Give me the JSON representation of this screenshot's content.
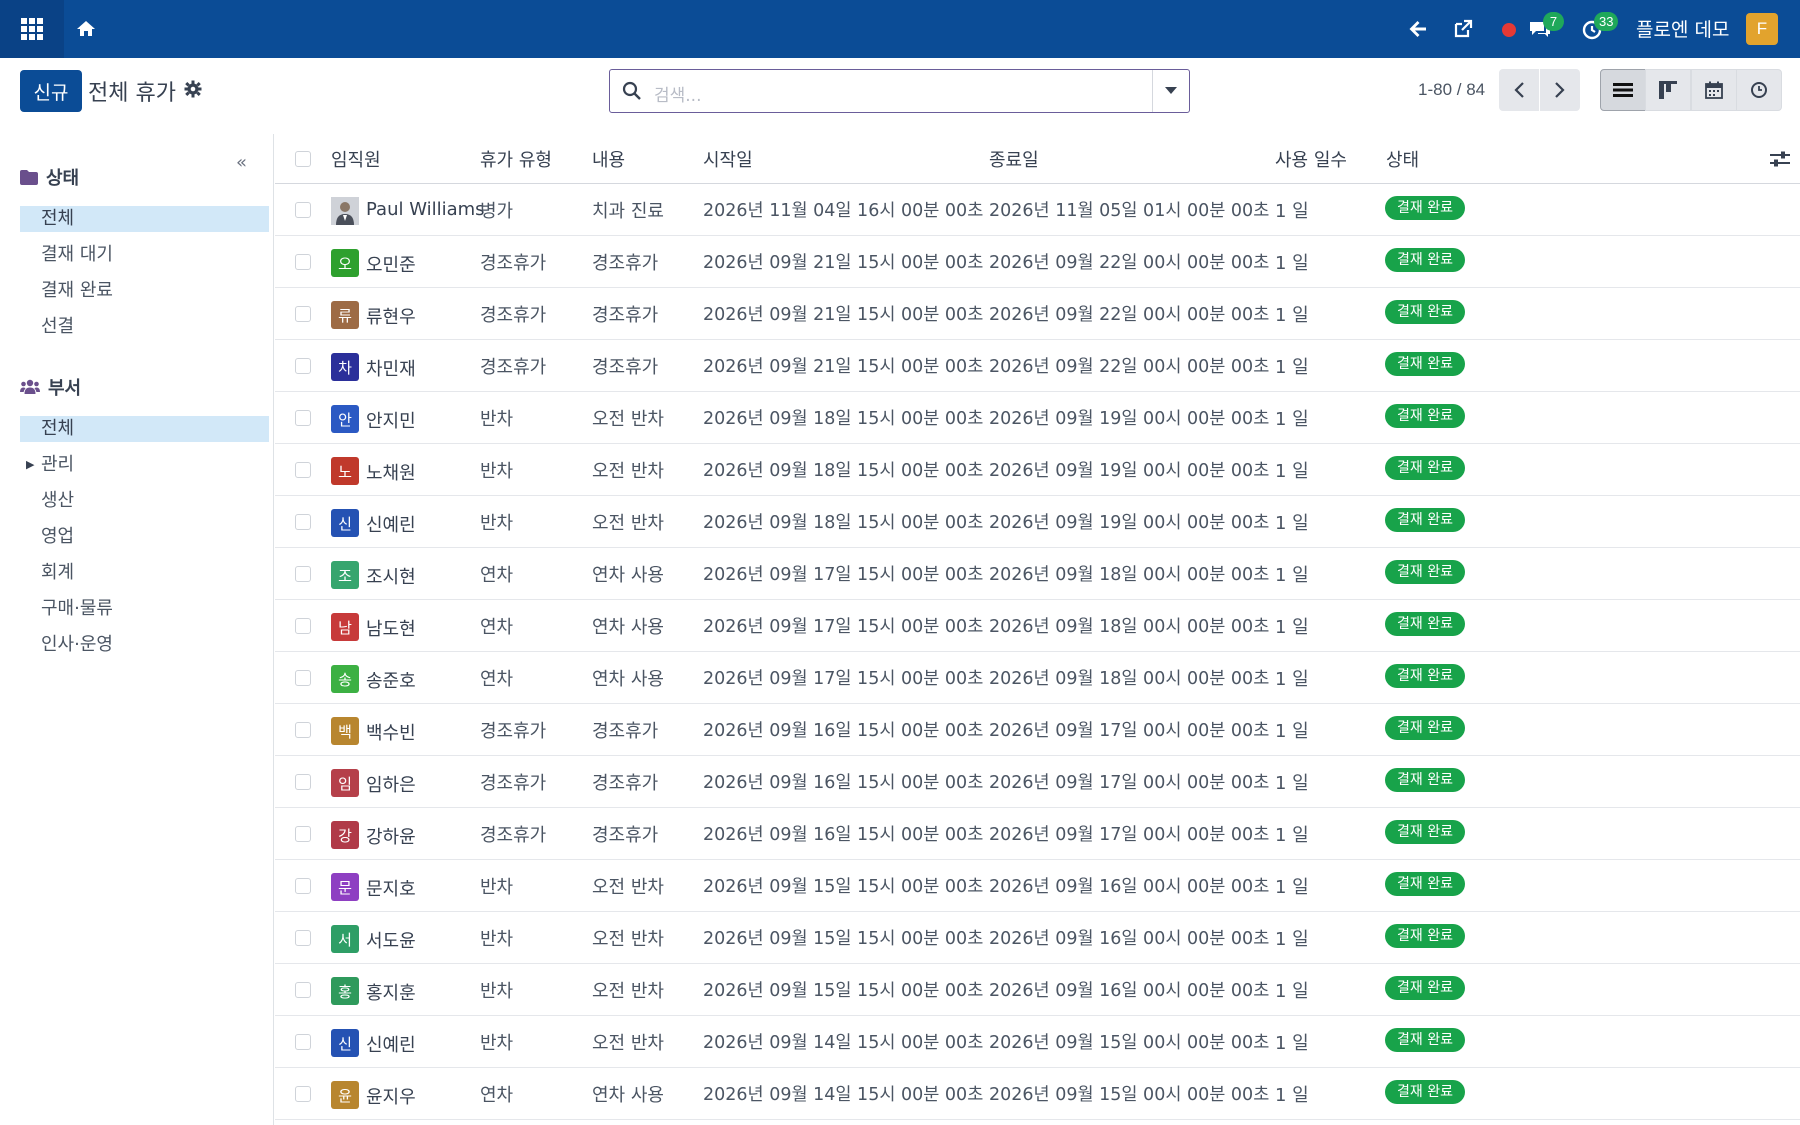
{
  "navbar": {
    "user_name": "플로엔 데모",
    "user_initial": "F",
    "messages_count": "7",
    "activities_count": "33"
  },
  "control": {
    "new_label": "신규",
    "title": "전체 휴가",
    "search_placeholder": "검색...",
    "pager": "1-80 / 84"
  },
  "sidebar": {
    "status_header": "상태",
    "status_items": [
      "전체",
      "결재 대기",
      "결재 완료",
      "선결"
    ],
    "dept_header": "부서",
    "dept_items": [
      "전체",
      "관리",
      "생산",
      "영업",
      "회계",
      "구매·물류",
      "인사·운영"
    ]
  },
  "table": {
    "headers": {
      "employee": "임직원",
      "leave_type": "휴가 유형",
      "description": "내용",
      "start": "시작일",
      "end": "종료일",
      "days": "사용 일수",
      "state": "상태"
    },
    "rows": [
      {
        "initial": "",
        "name": "Paul Williams",
        "type": "병가",
        "desc": "치과 진료",
        "start": "2026년 11월 04일 16시 00분 00초",
        "end": "2026년 11월 05일 01시 00분 00초",
        "days": "1 일",
        "state": "결재 완료",
        "color": "#9ca3af"
      },
      {
        "initial": "오",
        "name": "오민준",
        "type": "경조휴가",
        "desc": "경조휴가",
        "start": "2026년 09월 21일 15시 00분 00초",
        "end": "2026년 09월 22일 00시 00분 00초",
        "days": "1 일",
        "state": "결재 완료",
        "color": "#2ea02e"
      },
      {
        "initial": "류",
        "name": "류현우",
        "type": "경조휴가",
        "desc": "경조휴가",
        "start": "2026년 09월 21일 15시 00분 00초",
        "end": "2026년 09월 22일 00시 00분 00초",
        "days": "1 일",
        "state": "결재 완료",
        "color": "#9d6b45"
      },
      {
        "initial": "차",
        "name": "차민재",
        "type": "경조휴가",
        "desc": "경조휴가",
        "start": "2026년 09월 21일 15시 00분 00초",
        "end": "2026년 09월 22일 00시 00분 00초",
        "days": "1 일",
        "state": "결재 완료",
        "color": "#2b2f9a"
      },
      {
        "initial": "안",
        "name": "안지민",
        "type": "반차",
        "desc": "오전 반차",
        "start": "2026년 09월 18일 15시 00분 00초",
        "end": "2026년 09월 19일 00시 00분 00초",
        "days": "1 일",
        "state": "결재 완료",
        "color": "#2b59c3"
      },
      {
        "initial": "노",
        "name": "노채원",
        "type": "반차",
        "desc": "오전 반차",
        "start": "2026년 09월 18일 15시 00분 00초",
        "end": "2026년 09월 19일 00시 00분 00초",
        "days": "1 일",
        "state": "결재 완료",
        "color": "#c0392b"
      },
      {
        "initial": "신",
        "name": "신예린",
        "type": "반차",
        "desc": "오전 반차",
        "start": "2026년 09월 18일 15시 00분 00초",
        "end": "2026년 09월 19일 00시 00분 00초",
        "days": "1 일",
        "state": "결재 완료",
        "color": "#2552b3"
      },
      {
        "initial": "조",
        "name": "조시현",
        "type": "연차",
        "desc": "연차 사용",
        "start": "2026년 09월 17일 15시 00분 00초",
        "end": "2026년 09월 18일 00시 00분 00초",
        "days": "1 일",
        "state": "결재 완료",
        "color": "#36a56e"
      },
      {
        "initial": "남",
        "name": "남도현",
        "type": "연차",
        "desc": "연차 사용",
        "start": "2026년 09월 17일 15시 00분 00초",
        "end": "2026년 09월 18일 00시 00분 00초",
        "days": "1 일",
        "state": "결재 완료",
        "color": "#c73a3a"
      },
      {
        "initial": "송",
        "name": "송준호",
        "type": "연차",
        "desc": "연차 사용",
        "start": "2026년 09월 17일 15시 00분 00초",
        "end": "2026년 09월 18일 00시 00분 00초",
        "days": "1 일",
        "state": "결재 완료",
        "color": "#3cb043"
      },
      {
        "initial": "백",
        "name": "백수빈",
        "type": "경조휴가",
        "desc": "경조휴가",
        "start": "2026년 09월 16일 15시 00분 00초",
        "end": "2026년 09월 17일 00시 00분 00초",
        "days": "1 일",
        "state": "결재 완료",
        "color": "#b8862f"
      },
      {
        "initial": "임",
        "name": "임하은",
        "type": "경조휴가",
        "desc": "경조휴가",
        "start": "2026년 09월 16일 15시 00분 00초",
        "end": "2026년 09월 17일 00시 00분 00초",
        "days": "1 일",
        "state": "결재 완료",
        "color": "#b5404a"
      },
      {
        "initial": "강",
        "name": "강하윤",
        "type": "경조휴가",
        "desc": "경조휴가",
        "start": "2026년 09월 16일 15시 00분 00초",
        "end": "2026년 09월 17일 00시 00분 00초",
        "days": "1 일",
        "state": "결재 완료",
        "color": "#b03a48"
      },
      {
        "initial": "문",
        "name": "문지호",
        "type": "반차",
        "desc": "오전 반차",
        "start": "2026년 09월 15일 15시 00분 00초",
        "end": "2026년 09월 16일 00시 00분 00초",
        "days": "1 일",
        "state": "결재 완료",
        "color": "#8e3fc2"
      },
      {
        "initial": "서",
        "name": "서도윤",
        "type": "반차",
        "desc": "오전 반차",
        "start": "2026년 09월 15일 15시 00분 00초",
        "end": "2026년 09월 16일 00시 00분 00초",
        "days": "1 일",
        "state": "결재 완료",
        "color": "#2e9e66"
      },
      {
        "initial": "홍",
        "name": "홍지훈",
        "type": "반차",
        "desc": "오전 반차",
        "start": "2026년 09월 15일 15시 00분 00초",
        "end": "2026년 09월 16일 00시 00분 00초",
        "days": "1 일",
        "state": "결재 완료",
        "color": "#2f9a5c"
      },
      {
        "initial": "신",
        "name": "신예린",
        "type": "반차",
        "desc": "오전 반차",
        "start": "2026년 09월 14일 15시 00분 00초",
        "end": "2026년 09월 15일 00시 00분 00초",
        "days": "1 일",
        "state": "결재 완료",
        "color": "#2552b3"
      },
      {
        "initial": "윤",
        "name": "윤지우",
        "type": "연차",
        "desc": "연차 사용",
        "start": "2026년 09월 14일 15시 00분 00초",
        "end": "2026년 09월 15일 00시 00분 00초",
        "days": "1 일",
        "state": "결재 완료",
        "color": "#b8862f"
      }
    ]
  }
}
